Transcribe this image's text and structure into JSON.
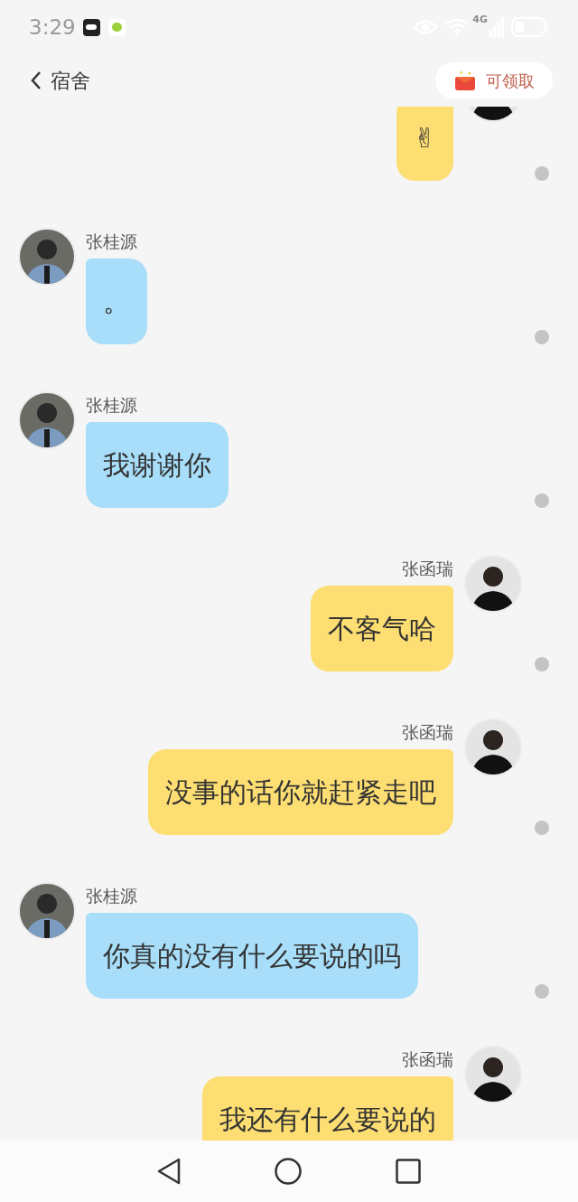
{
  "status_bar": {
    "time": "3:29",
    "network": "4G"
  },
  "header": {
    "title": "宿舍",
    "reward_button": "可领取"
  },
  "messages": [
    {
      "kind": "outgoing",
      "text": "✌"
    },
    {
      "kind": "incoming",
      "sender": "张桂源",
      "text": "。"
    },
    {
      "kind": "incoming",
      "sender": "张桂源",
      "text": "我谢谢你"
    },
    {
      "kind": "outgoing",
      "sender": "张函瑞",
      "text": "不客气哈"
    },
    {
      "kind": "outgoing",
      "sender": "张函瑞",
      "text": "没事的话你就赶紧走吧"
    },
    {
      "kind": "incoming",
      "sender": "张桂源",
      "text": "你真的没有什么要说的吗"
    },
    {
      "kind": "outgoing",
      "sender": "张函瑞",
      "text": "我还有什么要说的"
    }
  ]
}
